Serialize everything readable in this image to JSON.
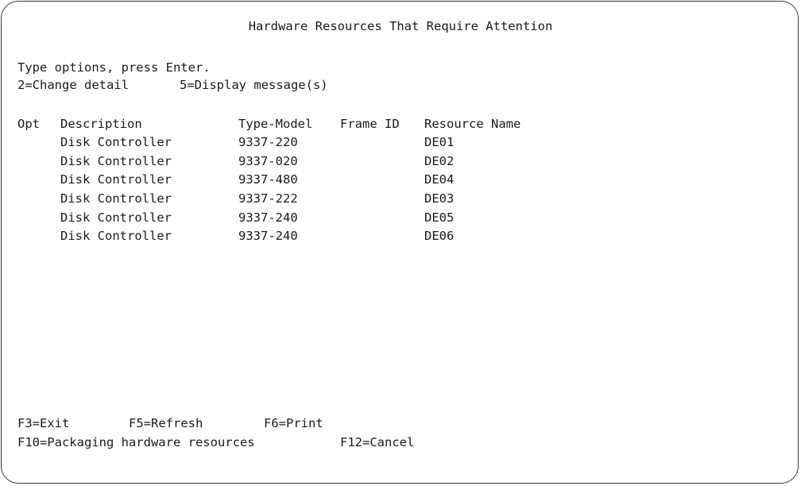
{
  "screen": {
    "title": "Hardware Resources That Require Attention",
    "instruction": "Type options, press Enter.",
    "options": [
      "2=Change detail",
      "5=Display message(s)"
    ]
  },
  "table": {
    "headers": {
      "opt": "Opt",
      "description": "Description",
      "type_model": "Type-Model",
      "frame_id": "Frame ID",
      "resource_name": "Resource Name"
    },
    "rows": [
      {
        "opt": "",
        "description": "Disk Controller",
        "type_model": "9337-220",
        "frame_id": "",
        "resource_name": "DE01"
      },
      {
        "opt": "",
        "description": "Disk Controller",
        "type_model": "9337-020",
        "frame_id": "",
        "resource_name": "DE02"
      },
      {
        "opt": "",
        "description": "Disk Controller",
        "type_model": "9337-480",
        "frame_id": "",
        "resource_name": "DE04"
      },
      {
        "opt": "",
        "description": "Disk Controller",
        "type_model": "9337-222",
        "frame_id": "",
        "resource_name": "DE03"
      },
      {
        "opt": "",
        "description": "Disk Controller",
        "type_model": "9337-240",
        "frame_id": "",
        "resource_name": "DE05"
      },
      {
        "opt": "",
        "description": "Disk Controller",
        "type_model": "9337-240",
        "frame_id": "",
        "resource_name": "DE06"
      }
    ]
  },
  "function_keys": {
    "row1": [
      "F3=Exit",
      "F5=Refresh",
      "F6=Print"
    ],
    "row2": [
      "F10=Packaging hardware resources",
      "F12=Cancel"
    ]
  }
}
